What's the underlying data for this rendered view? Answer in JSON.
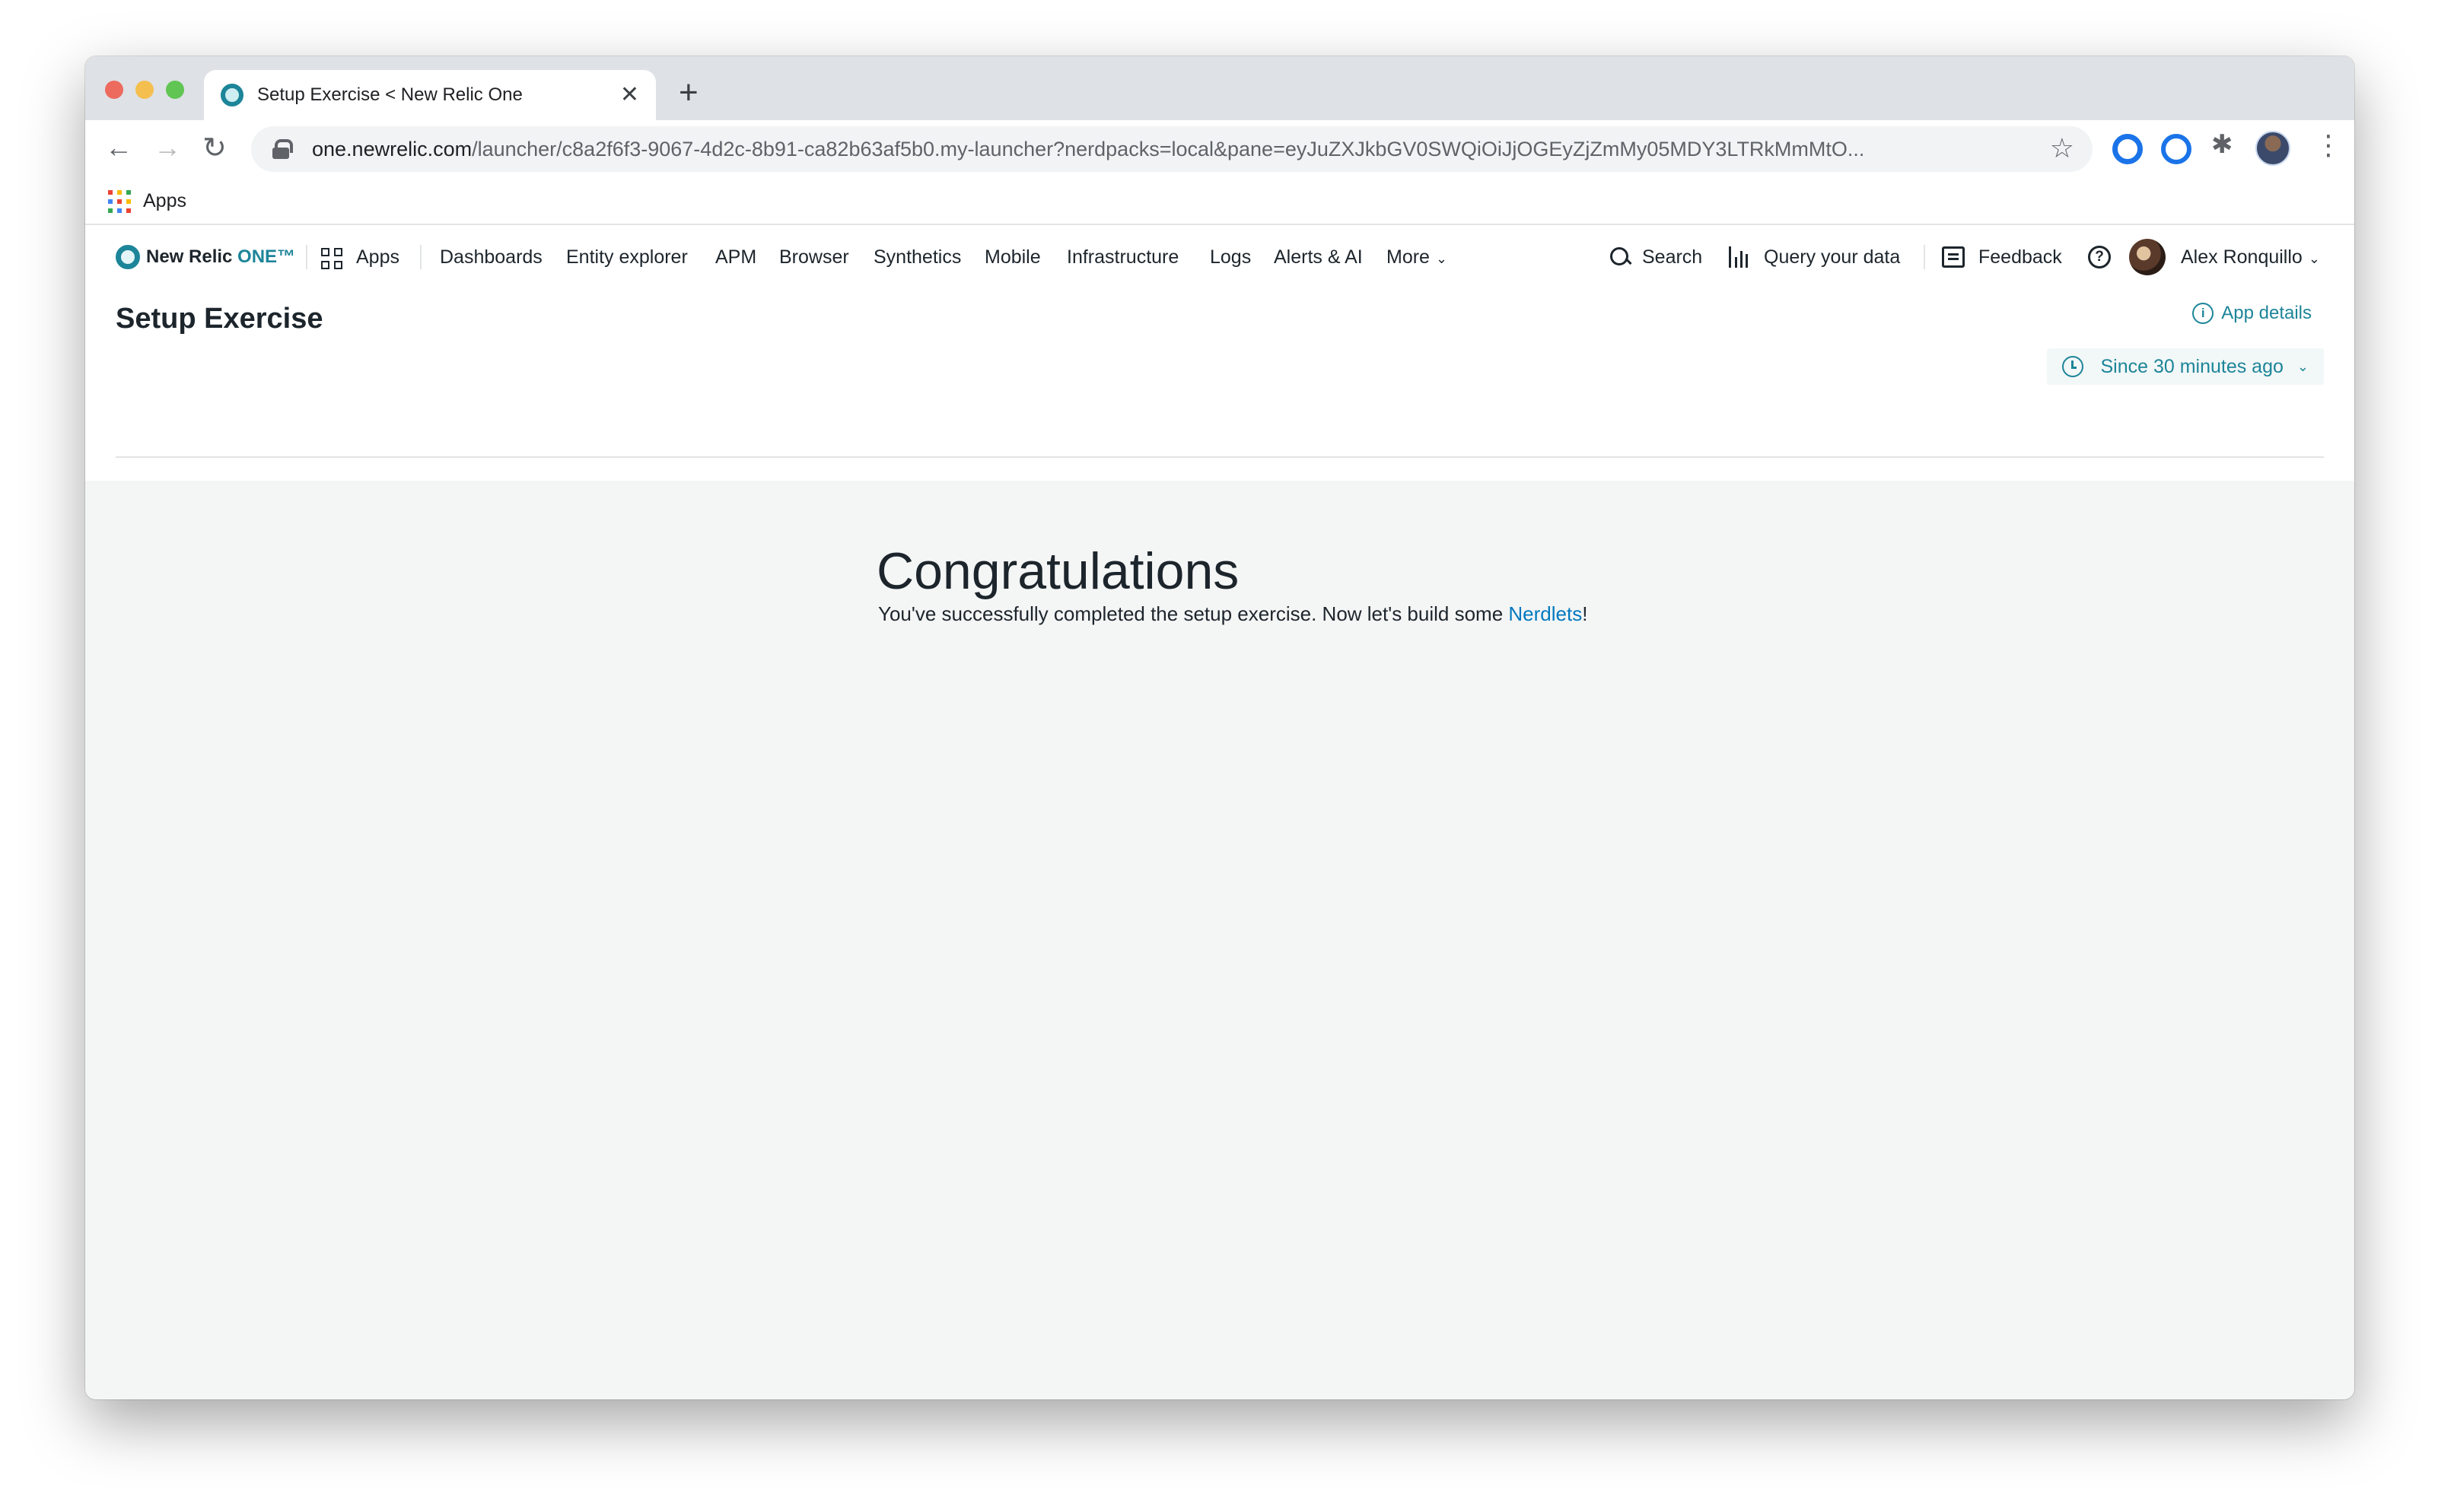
{
  "browser": {
    "tab_title": "Setup Exercise < New Relic One",
    "url_host": "one.newrelic.com",
    "url_path": "/launcher/c8a2f6f3-9067-4d2c-8b91-ca82b63af5b0.my-launcher?nerdpacks=local&pane=eyJuZXJkbGV0SWQiOiJjOGEyZjZmMy05MDY3LTRkMmMtO...",
    "bookmarks_apps_label": "Apps"
  },
  "nav": {
    "logo_text": "New Relic ",
    "logo_one": "ONE™",
    "apps": "Apps",
    "dashboards": "Dashboards",
    "entity_explorer": "Entity explorer",
    "apm": "APM",
    "browser": "Browser",
    "synthetics": "Synthetics",
    "mobile": "Mobile",
    "infrastructure": "Infrastructure",
    "logs": "Logs",
    "alerts": "Alerts & AI",
    "more": "More",
    "search": "Search",
    "query": "Query your data",
    "feedback": "Feedback",
    "user_name": "Alex Ronquillo"
  },
  "header": {
    "title": "Setup Exercise",
    "app_details": "App details",
    "time_range": "Since 30 minutes ago"
  },
  "content": {
    "title": "Congratulations",
    "message": "You've successfully completed the setup exercise. Now let's build some ",
    "link_text": "Nerdlets",
    "message_end": "!"
  },
  "colors": {
    "accent": "#1d8599",
    "link": "#0079bf",
    "text": "#1d252c",
    "content_bg": "#f4f5f5"
  }
}
